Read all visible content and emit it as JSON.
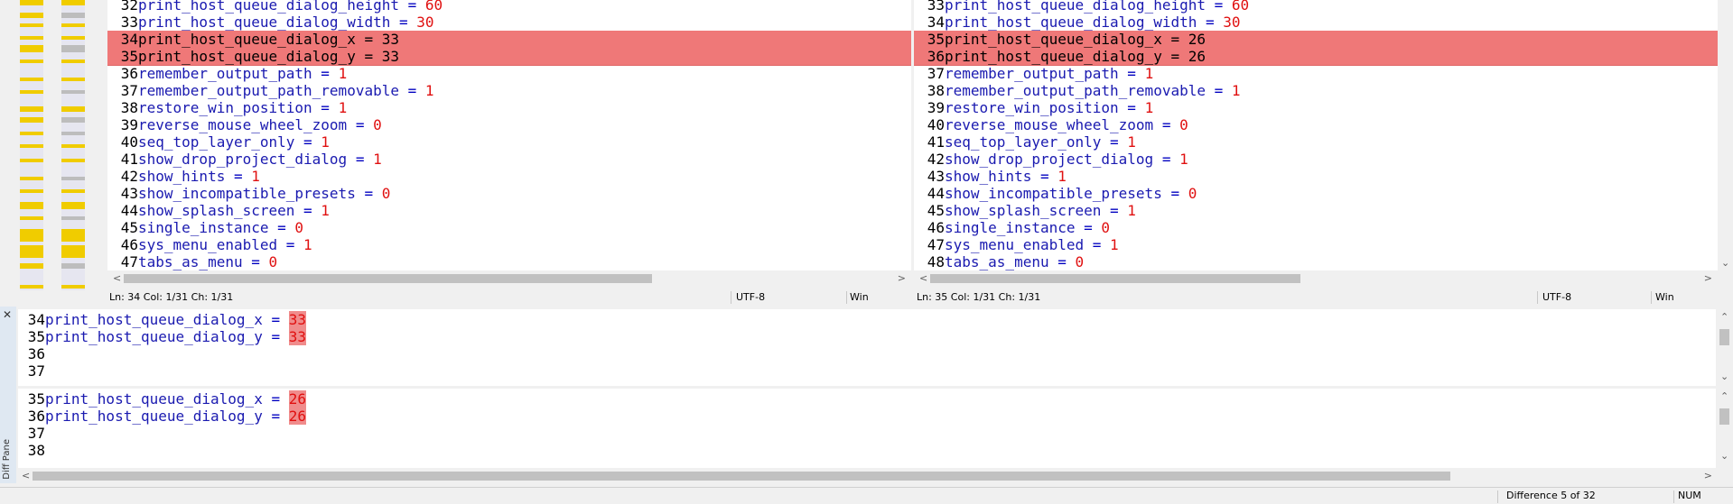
{
  "left_pane": {
    "lines": [
      {
        "n": "32",
        "key": "print_host_queue_dialog_height",
        "val": "60",
        "diff": false
      },
      {
        "n": "33",
        "key": "print_host_queue_dialog_width",
        "val": "30",
        "diff": false
      },
      {
        "n": "34",
        "key": "print_host_queue_dialog_x",
        "val": "33",
        "diff": true
      },
      {
        "n": "35",
        "key": "print_host_queue_dialog_y",
        "val": "33",
        "diff": true
      },
      {
        "n": "36",
        "key": "remember_output_path",
        "val": "1",
        "diff": false
      },
      {
        "n": "37",
        "key": "remember_output_path_removable",
        "val": "1",
        "diff": false
      },
      {
        "n": "38",
        "key": "restore_win_position",
        "val": "1",
        "diff": false
      },
      {
        "n": "39",
        "key": "reverse_mouse_wheel_zoom",
        "val": "0",
        "diff": false
      },
      {
        "n": "40",
        "key": "seq_top_layer_only",
        "val": "1",
        "diff": false
      },
      {
        "n": "41",
        "key": "show_drop_project_dialog",
        "val": "1",
        "diff": false
      },
      {
        "n": "42",
        "key": "show_hints",
        "val": "1",
        "diff": false
      },
      {
        "n": "43",
        "key": "show_incompatible_presets",
        "val": "0",
        "diff": false
      },
      {
        "n": "44",
        "key": "show_splash_screen",
        "val": "1",
        "diff": false
      },
      {
        "n": "45",
        "key": "single_instance",
        "val": "0",
        "diff": false
      },
      {
        "n": "46",
        "key": "sys_menu_enabled",
        "val": "1",
        "diff": false
      },
      {
        "n": "47",
        "key": "tabs_as_menu",
        "val": "0",
        "diff": false
      }
    ],
    "status": {
      "pos": "Ln: 34  Col: 1/31  Ch: 1/31",
      "enc": "UTF-8",
      "eol": "Win"
    }
  },
  "right_pane": {
    "lines": [
      {
        "n": "33",
        "key": "print_host_queue_dialog_height",
        "val": "60",
        "diff": false
      },
      {
        "n": "34",
        "key": "print_host_queue_dialog_width",
        "val": "30",
        "diff": false
      },
      {
        "n": "35",
        "key": "print_host_queue_dialog_x",
        "val": "26",
        "diff": true
      },
      {
        "n": "36",
        "key": "print_host_queue_dialog_y",
        "val": "26",
        "diff": true
      },
      {
        "n": "37",
        "key": "remember_output_path",
        "val": "1",
        "diff": false
      },
      {
        "n": "38",
        "key": "remember_output_path_removable",
        "val": "1",
        "diff": false
      },
      {
        "n": "39",
        "key": "restore_win_position",
        "val": "1",
        "diff": false
      },
      {
        "n": "40",
        "key": "reverse_mouse_wheel_zoom",
        "val": "0",
        "diff": false
      },
      {
        "n": "41",
        "key": "seq_top_layer_only",
        "val": "1",
        "diff": false
      },
      {
        "n": "42",
        "key": "show_drop_project_dialog",
        "val": "1",
        "diff": false
      },
      {
        "n": "43",
        "key": "show_hints",
        "val": "1",
        "diff": false
      },
      {
        "n": "44",
        "key": "show_incompatible_presets",
        "val": "0",
        "diff": false
      },
      {
        "n": "45",
        "key": "show_splash_screen",
        "val": "1",
        "diff": false
      },
      {
        "n": "46",
        "key": "single_instance",
        "val": "0",
        "diff": false
      },
      {
        "n": "47",
        "key": "sys_menu_enabled",
        "val": "1",
        "diff": false
      },
      {
        "n": "48",
        "key": "tabs_as_menu",
        "val": "0",
        "diff": false
      }
    ],
    "status": {
      "pos": "Ln: 35  Col: 1/31  Ch: 1/31",
      "enc": "UTF-8",
      "eol": "Win"
    }
  },
  "diff_pane": {
    "label": "Diff Pane",
    "close_glyph": "✕",
    "top": [
      {
        "n": "34",
        "key": "print_host_queue_dialog_x",
        "val": "33"
      },
      {
        "n": "35",
        "key": "print_host_queue_dialog_y",
        "val": "33"
      },
      {
        "n": "36",
        "key": "",
        "val": ""
      },
      {
        "n": "37",
        "key": "",
        "val": ""
      }
    ],
    "bottom": [
      {
        "n": "35",
        "key": "print_host_queue_dialog_x",
        "val": "26"
      },
      {
        "n": "36",
        "key": "print_host_queue_dialog_y",
        "val": "26"
      },
      {
        "n": "37",
        "key": "",
        "val": ""
      },
      {
        "n": "38",
        "key": "",
        "val": ""
      }
    ]
  },
  "status_bar": {
    "difference": "Difference 5 of 32",
    "num": "NUM"
  },
  "colors": {
    "diff_bg": "#ef7878",
    "key": "#1a1ab0",
    "value": "#e01010",
    "loc_mark": "#f0cc00"
  }
}
